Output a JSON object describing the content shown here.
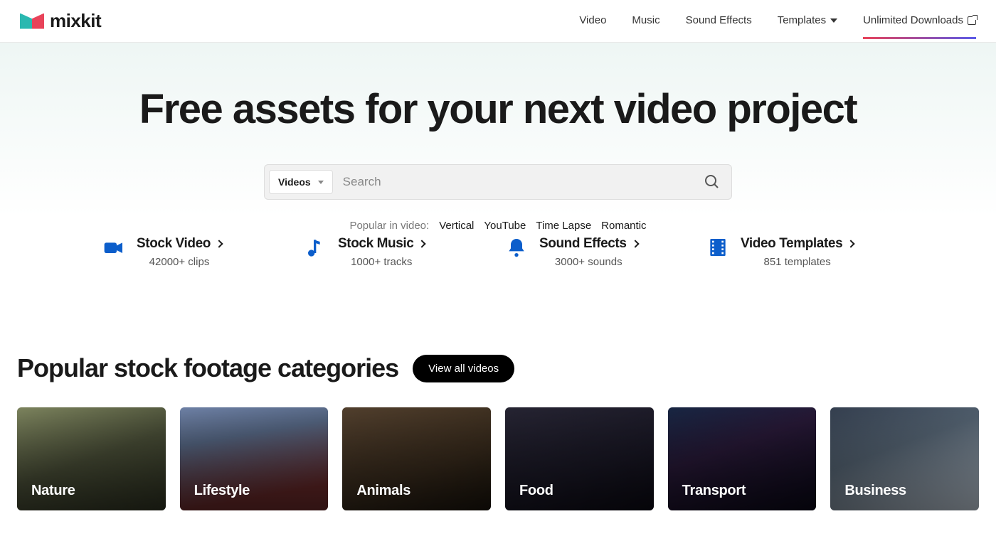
{
  "brand": "mixkit",
  "nav": {
    "items": [
      "Video",
      "Music",
      "Sound Effects",
      "Templates",
      "Unlimited Downloads"
    ]
  },
  "hero": {
    "title": "Free assets for your next video project",
    "search": {
      "filter_label": "Videos",
      "placeholder": "Search"
    },
    "popular_label": "Popular in video:",
    "popular_tags": [
      "Vertical",
      "YouTube",
      "Time Lapse",
      "Romantic"
    ]
  },
  "asset_types": [
    {
      "title": "Stock Video",
      "sub": "42000+ clips"
    },
    {
      "title": "Stock Music",
      "sub": "1000+ tracks"
    },
    {
      "title": "Sound Effects",
      "sub": "3000+ sounds"
    },
    {
      "title": "Video Templates",
      "sub": "851 templates"
    }
  ],
  "categories": {
    "heading": "Popular stock footage categories",
    "view_all": "View all videos",
    "tiles": [
      "Nature",
      "Lifestyle",
      "Animals",
      "Food",
      "Transport",
      "Business"
    ]
  }
}
